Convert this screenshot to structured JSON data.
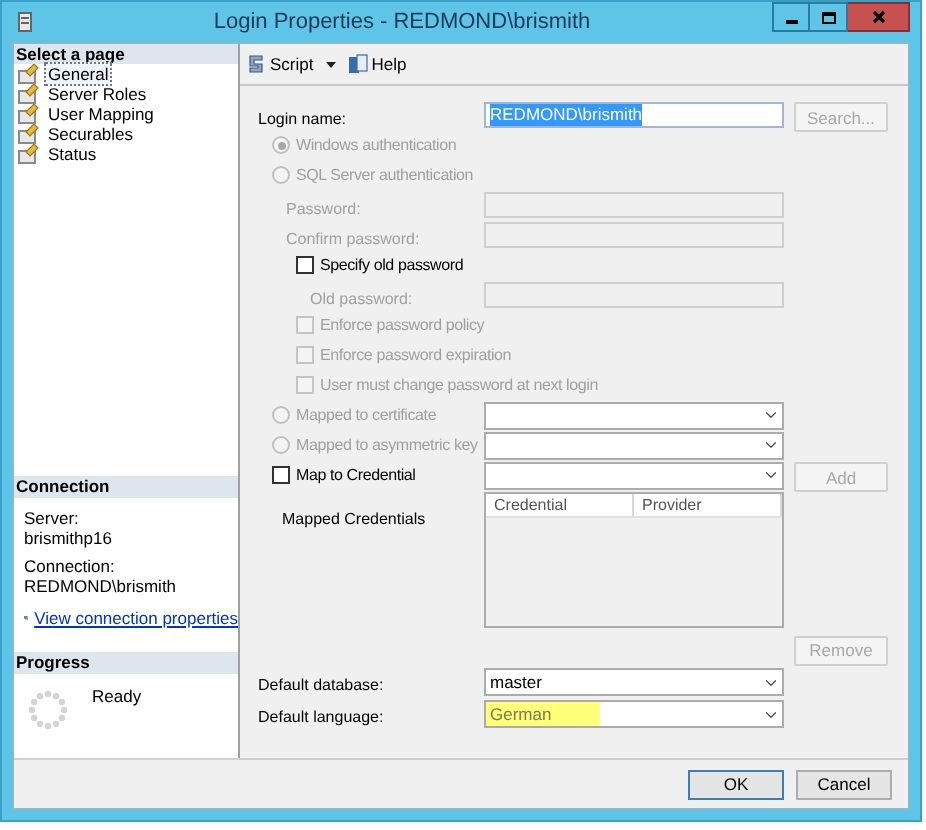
{
  "window": {
    "title": "Login Properties - REDMOND\\brismith"
  },
  "sidebar": {
    "select_page": {
      "heading": "Select a page",
      "items": [
        {
          "label": "General",
          "selected": true
        },
        {
          "label": "Server Roles",
          "selected": false
        },
        {
          "label": "User Mapping",
          "selected": false
        },
        {
          "label": "Securables",
          "selected": false
        },
        {
          "label": "Status",
          "selected": false
        }
      ]
    },
    "connection": {
      "heading": "Connection",
      "server_label": "Server:",
      "server": "brismithp16",
      "connection_label": "Connection:",
      "connection": "REDMOND\\brismith",
      "link": "View connection properties"
    },
    "progress": {
      "heading": "Progress",
      "status": "Ready"
    }
  },
  "toolbar": [
    {
      "label": "Script",
      "kind": "dropdown"
    },
    {
      "label": "Help",
      "kind": "plain"
    }
  ],
  "form": [
    {
      "kind": "field",
      "label": "Login name:",
      "value": "REDMOND\\brismith",
      "disabled": false,
      "text_selected": true,
      "button": {
        "label": "Search...",
        "disabled": true
      }
    },
    {
      "kind": "radio",
      "label": "Windows authentication",
      "selected": true,
      "disabled": true
    },
    {
      "kind": "radio",
      "label": "SQL Server authentication",
      "selected": false,
      "disabled": true,
      "children": [
        {
          "kind": "field",
          "label": "Password:",
          "disabled": true
        },
        {
          "kind": "field",
          "label": "Confirm password:",
          "disabled": true
        },
        {
          "kind": "checkbox",
          "label": "Specify old password",
          "checked": false,
          "disabled": false,
          "children": [
            {
              "kind": "field",
              "label": "Old password:",
              "disabled": true
            }
          ]
        },
        {
          "kind": "checkbox",
          "label": "Enforce password policy",
          "checked": false,
          "disabled": true
        },
        {
          "kind": "checkbox",
          "label": "Enforce password expiration",
          "checked": false,
          "disabled": true
        },
        {
          "kind": "checkbox",
          "label": "User must change password at next login",
          "checked": false,
          "disabled": true
        }
      ]
    },
    {
      "kind": "radio",
      "label": "Mapped to certificate",
      "selected": false,
      "disabled": true,
      "has_dropdown": true
    },
    {
      "kind": "radio",
      "label": "Mapped to asymmetric key",
      "selected": false,
      "disabled": true,
      "has_dropdown": true
    },
    {
      "kind": "checkbox",
      "label": "Map to Credential",
      "checked": false,
      "disabled": false,
      "has_dropdown": true,
      "button": {
        "label": "Add",
        "disabled": true
      },
      "children": [
        {
          "kind": "grid",
          "label": "Mapped Credentials",
          "columns": [
            "Credential",
            "Provider"
          ],
          "button": {
            "label": "Remove",
            "disabled": true
          }
        }
      ]
    },
    {
      "kind": "dropdown",
      "label": "Default database:",
      "value": "master",
      "highlighted": false
    },
    {
      "kind": "dropdown",
      "label": "Default language:",
      "value": "German",
      "highlighted": true
    }
  ],
  "footer": {
    "buttons": [
      "OK",
      "Cancel"
    ]
  }
}
